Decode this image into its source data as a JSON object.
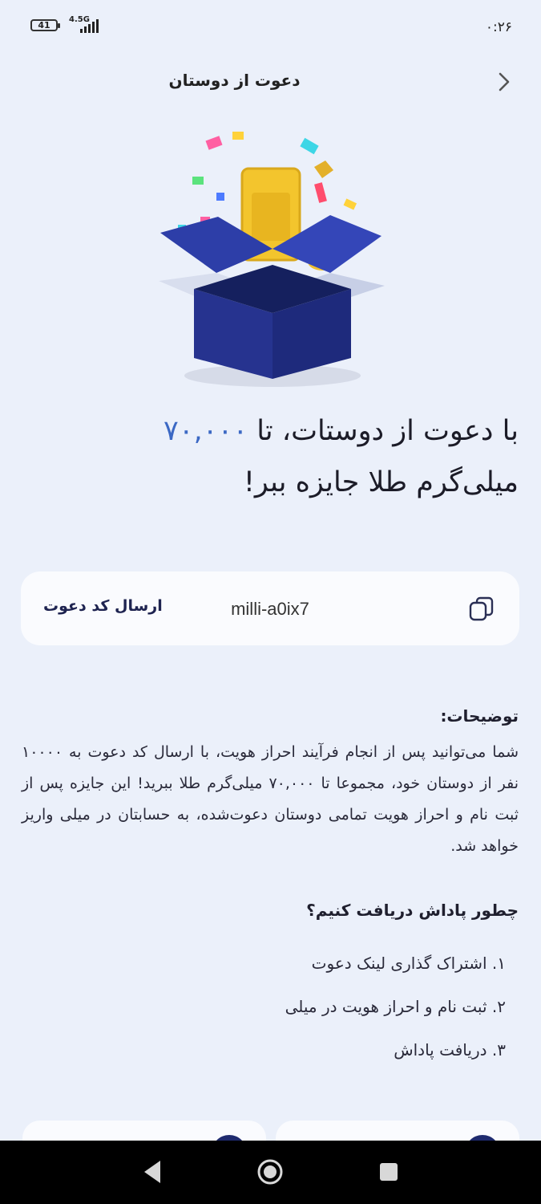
{
  "status": {
    "battery": "41",
    "network": "4.5G",
    "time": "۰:۲۶"
  },
  "header": {
    "title": "دعوت از دوستان"
  },
  "hero": {
    "line1_prefix": "با دعوت از دوستات، تا ",
    "amount": "۷۰,۰۰۰",
    "line2": "میلی‌گرم طلا جایزه ببر!"
  },
  "invite": {
    "send_label": "ارسال کد دعوت",
    "code": "milli-a0ix7"
  },
  "description": {
    "title": "توضیحات:",
    "body": "شما می‌توانید پس از انجام فرآیند احراز هویت، با ارسال کد دعوت به ۱۰۰۰۰ نفر از دوستان خود، مجموعا تا ۷۰,۰۰۰ میلی‌گرم طلا ببرید! این جایزه پس از ثبت نام و احراز هویت تمامی دوستان دعوت‌شده، به حسابتان در میلی واریز خواهد شد."
  },
  "how": {
    "title": "چطور پاداش دریافت کنیم؟",
    "steps": [
      "۱. اشتراک گذاری لینک دعوت",
      "۲. ثبت نام و احراز هویت در میلی",
      "۳. دریافت پاداش"
    ]
  },
  "colors": {
    "accent": "#3b68c4",
    "background": "#ebf0fa",
    "navy": "#1e2350"
  },
  "icons": [
    "chevron-right-icon",
    "copy-icon",
    "nav-back-icon",
    "nav-home-icon",
    "nav-recents-icon"
  ]
}
